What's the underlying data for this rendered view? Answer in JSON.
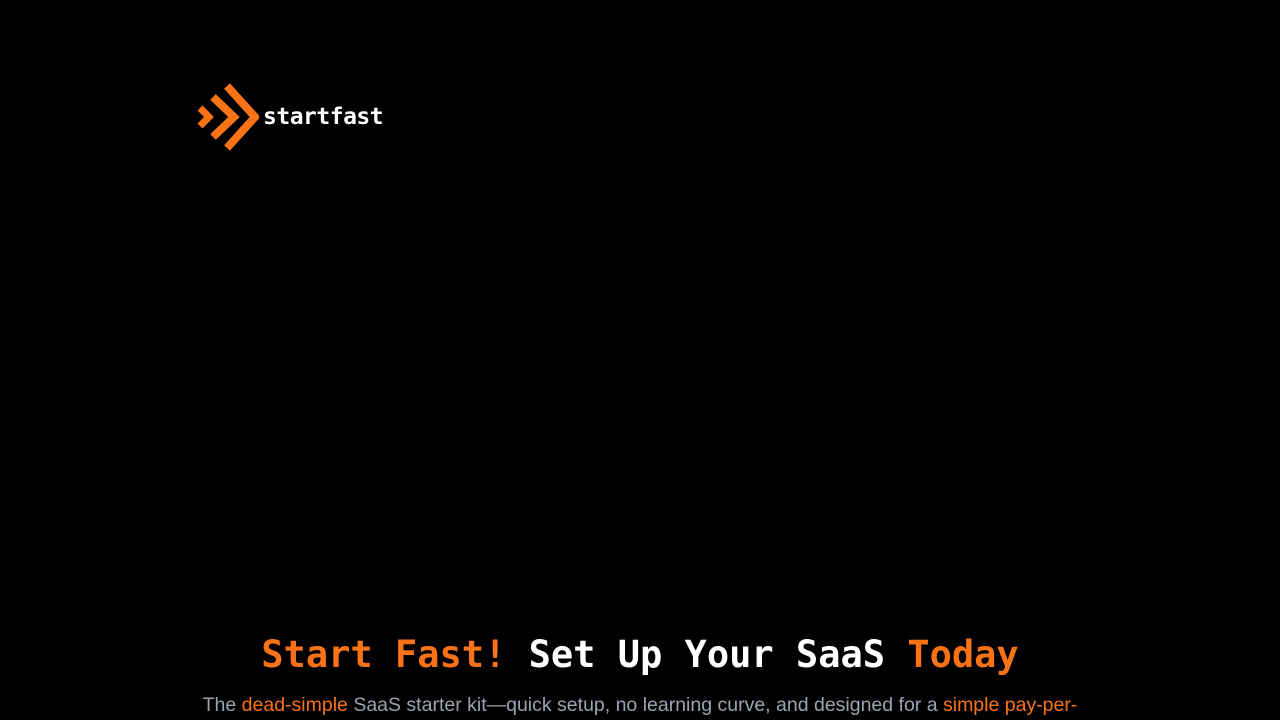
{
  "brand": {
    "name": "startfast",
    "accent_color": "#f97316",
    "logo_icon": "double-chevron-right-icon"
  },
  "hero": {
    "headline_part1": "Start Fast!",
    "headline_part2": "Set Up Your SaaS",
    "headline_part3": "Today",
    "sub_part1": "The",
    "sub_highlight1": "dead-simple",
    "sub_part2": "SaaS starter kit—quick setup, no learning curve, and designed for a",
    "sub_highlight2": "simple pay-per-"
  },
  "colors": {
    "background": "#000000",
    "text": "#ffffff",
    "muted": "#9ca3af"
  }
}
